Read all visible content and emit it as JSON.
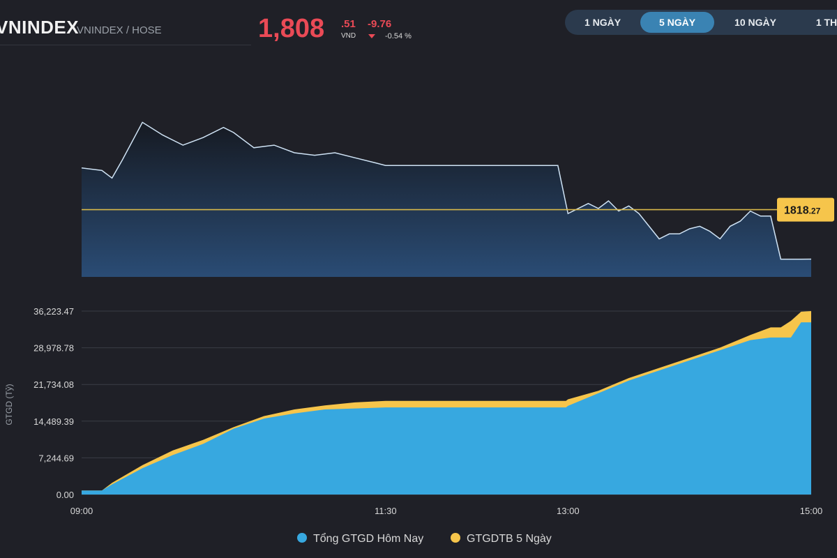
{
  "header": {
    "title": "VNINDEX",
    "subtitle": "VNINDEX / HOSE",
    "price_main": "1,808",
    "price_decimal": ".51",
    "price_unit": "VND",
    "change": "-9.76",
    "change_pct": "-0.54 %"
  },
  "tabs": [
    {
      "label": "1 NGÀY",
      "active": false
    },
    {
      "label": "5 NGÀY",
      "active": true
    },
    {
      "label": "10 NGÀY",
      "active": false
    },
    {
      "label": "1 TH",
      "active": false
    }
  ],
  "colors": {
    "negative": "#ea4a56",
    "price_line": "#cfe3f5",
    "reference_line": "#d9b94a",
    "today_value": "#37a8e0",
    "avg_5_day": "#f6c54b",
    "tab_active": "#3a83b3"
  },
  "chart_data": [
    {
      "type": "line",
      "reference": {
        "value": 1818.27,
        "label_int": "1818",
        "label_dec": ".27"
      },
      "x": [
        "09:00",
        "09:10",
        "09:15",
        "09:20",
        "09:30",
        "09:40",
        "09:50",
        "10:00",
        "10:10",
        "10:15",
        "10:25",
        "10:35",
        "10:45",
        "10:55",
        "11:05",
        "11:15",
        "11:25",
        "11:30",
        "11:40",
        "12:00",
        "12:20",
        "12:40",
        "12:55",
        "13:00",
        "13:05",
        "13:10",
        "13:15",
        "13:20",
        "13:25",
        "13:30",
        "13:35",
        "13:40",
        "13:45",
        "13:50",
        "13:55",
        "14:00",
        "14:05",
        "14:10",
        "14:15",
        "14:20",
        "14:25",
        "14:30",
        "14:35",
        "14:40",
        "14:45",
        "14:50",
        "14:55",
        "15:00"
      ],
      "values": [
        1826.5,
        1826.0,
        1824.5,
        1828.0,
        1835.5,
        1833.0,
        1831.0,
        1832.5,
        1834.5,
        1833.5,
        1830.5,
        1831.0,
        1829.5,
        1829.0,
        1829.5,
        1828.5,
        1827.5,
        1827.0,
        1827.0,
        1827.0,
        1827.0,
        1827.0,
        1827.0,
        1817.5,
        1818.5,
        1819.5,
        1818.5,
        1820.0,
        1818.0,
        1819.0,
        1817.5,
        1815.0,
        1812.5,
        1813.5,
        1813.5,
        1814.5,
        1815.0,
        1814.0,
        1812.5,
        1815.0,
        1816.0,
        1818.0,
        1817.0,
        1817.0,
        1808.5,
        1808.5,
        1808.5,
        1808.51
      ]
    },
    {
      "type": "area",
      "ylabel": "GTGD (Tỷ)",
      "x_ticks": [
        "09:00",
        "11:30",
        "13:00",
        "15:00"
      ],
      "y_ticks": [
        "0.00",
        "7,244.69",
        "14,489.39",
        "21,734.08",
        "28,978.78",
        "36,223.47"
      ],
      "ylim": [
        0,
        36223.47
      ],
      "x": [
        "09:00",
        "09:10",
        "09:15",
        "09:30",
        "09:45",
        "10:00",
        "10:15",
        "10:30",
        "10:45",
        "11:00",
        "11:15",
        "11:30",
        "11:45",
        "12:00",
        "12:20",
        "12:40",
        "12:59",
        "13:00",
        "13:15",
        "13:30",
        "13:45",
        "14:00",
        "14:15",
        "14:30",
        "14:40",
        "14:45",
        "14:50",
        "14:55",
        "15:00"
      ],
      "series": [
        {
          "name": "Tổng GTGD Hôm Nay",
          "values": [
            800,
            800,
            2000,
            5200,
            7800,
            10000,
            13000,
            15000,
            16000,
            16800,
            17000,
            17200,
            17200,
            17200,
            17200,
            17200,
            17200,
            17500,
            20000,
            22500,
            24500,
            26500,
            28500,
            30500,
            31000,
            31000,
            31000,
            34000,
            34000
          ]
        },
        {
          "name": "GTGDTB 5 Ngày",
          "values": [
            800,
            800,
            2300,
            5800,
            8700,
            10800,
            13300,
            15500,
            16800,
            17600,
            18200,
            18500,
            18500,
            18500,
            18500,
            18500,
            18500,
            18800,
            20500,
            23000,
            25000,
            27000,
            29000,
            31500,
            33000,
            33000,
            34300,
            36100,
            36223.47
          ]
        }
      ]
    }
  ]
}
